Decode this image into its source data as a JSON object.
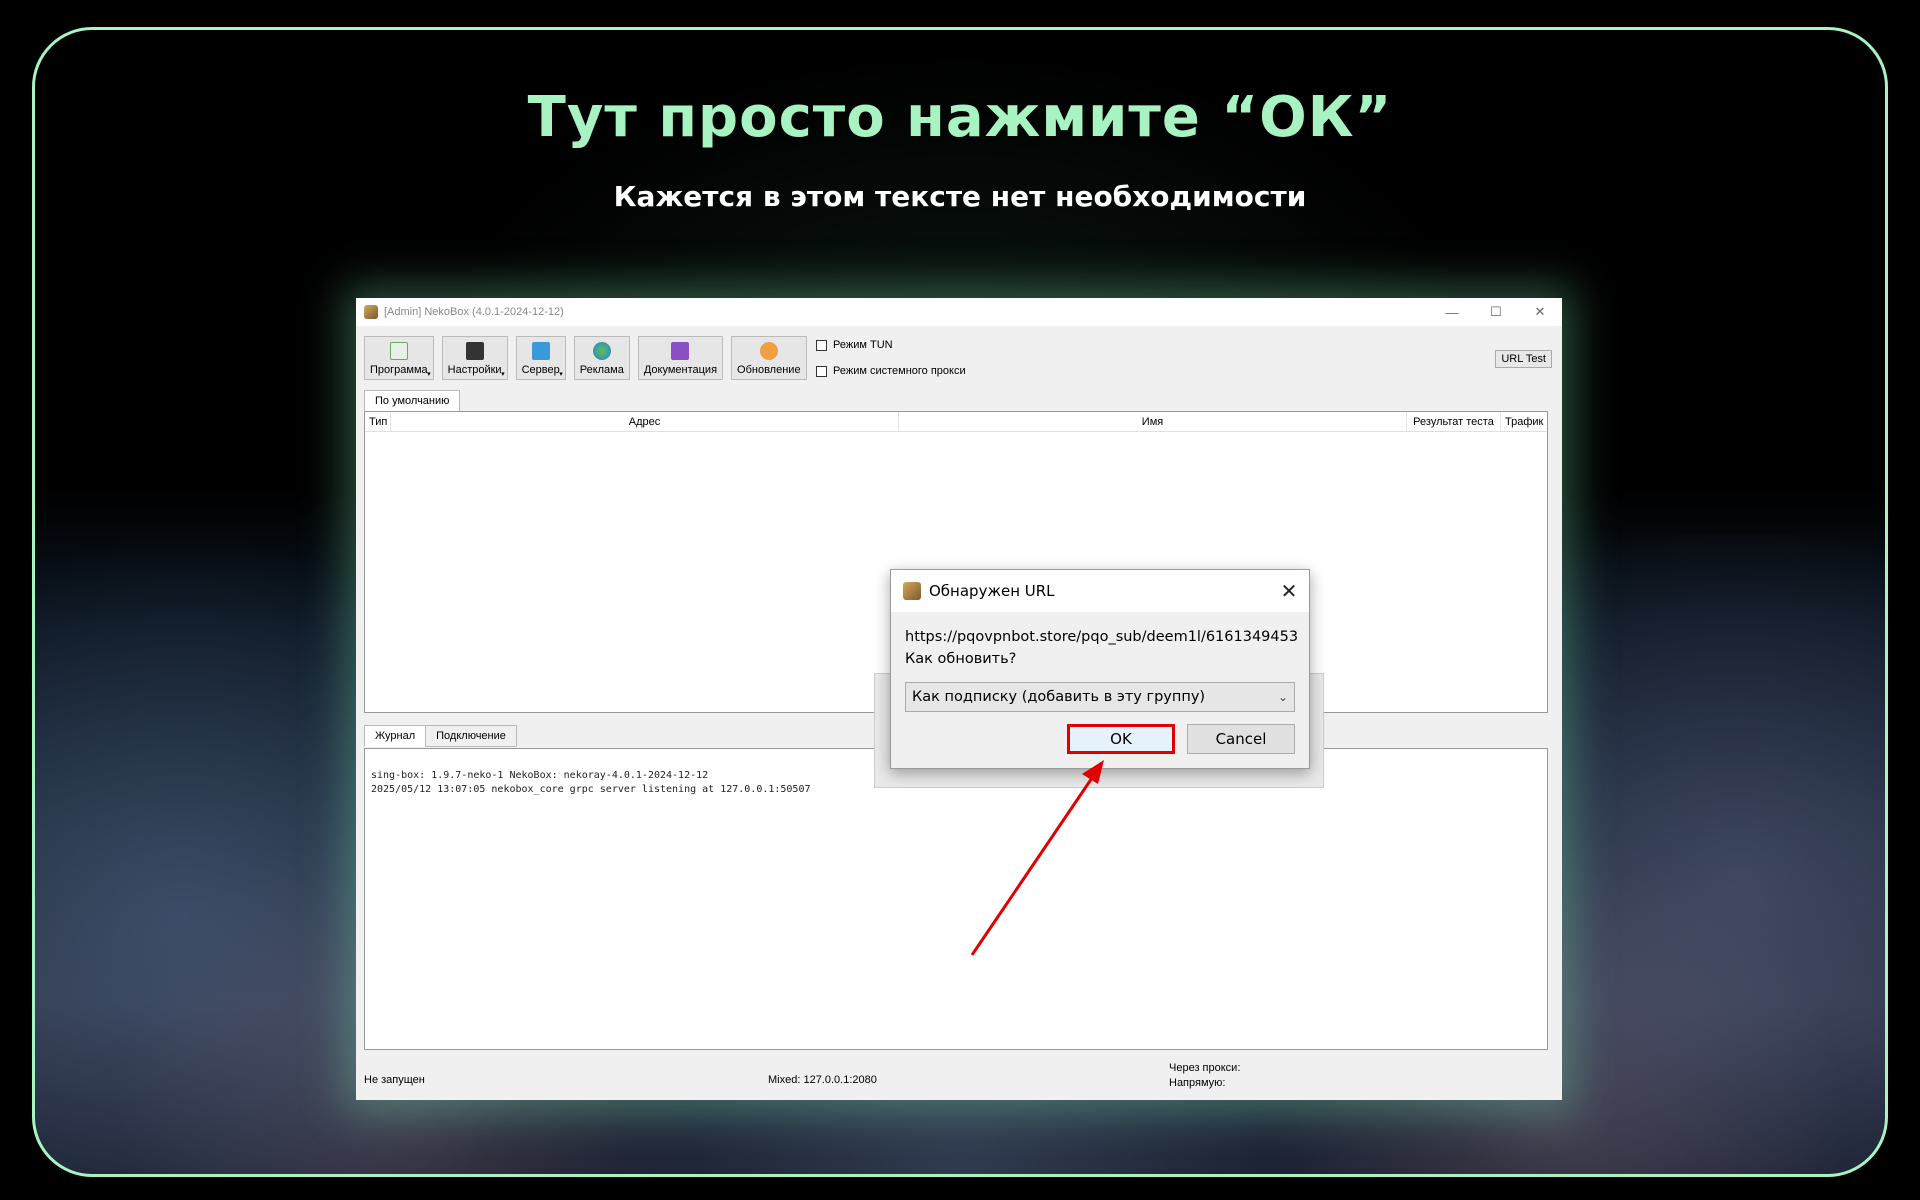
{
  "page": {
    "headline": "Тут просто нажмите “ОК”",
    "subheadline": "Кажется в этом тексте нет необходимости"
  },
  "colors": {
    "accent": "#a7f3c1",
    "highlight": "#e00000"
  },
  "window": {
    "title": "[Admin] NekoBox (4.0.1-2024-12-12)",
    "controls": [
      "minimize-icon",
      "maximize-icon",
      "close-icon"
    ],
    "toolbar": [
      {
        "label": "Программа",
        "icon": "program-icon",
        "dropdown": true
      },
      {
        "label": "Настройки",
        "icon": "settings-icon",
        "dropdown": true
      },
      {
        "label": "Сервер",
        "icon": "server-icon",
        "dropdown": true
      },
      {
        "label": "Реклама",
        "icon": "globe-icon",
        "dropdown": false
      },
      {
        "label": "Документация",
        "icon": "help-icon",
        "dropdown": false
      },
      {
        "label": "Обновление",
        "icon": "update-icon",
        "dropdown": false
      }
    ],
    "checkboxes": [
      "Режим TUN",
      "Режим системного прокси"
    ],
    "url_test": "URL Test",
    "group_tab": "По умолчанию",
    "table_headers": [
      "Тип",
      "Адрес",
      "Имя",
      "Результат теста",
      "Трафик"
    ],
    "log_tabs": [
      "Журнал",
      "Подключение"
    ],
    "log_lines": [
      "sing-box: 1.9.7-neko-1 NekoBox: nekoray-4.0.1-2024-12-12",
      "2025/05/12 13:07:05 nekobox_core grpc server listening at 127.0.0.1:50507"
    ],
    "status": {
      "state": "Не запущен",
      "mixed": "Mixed: 127.0.0.1:2080",
      "via_proxy": "Через прокси:",
      "direct": "Напрямую:"
    }
  },
  "dialog": {
    "title": "Обнаружен URL",
    "url": "https://pqovpnbot.store/pqo_sub/deem1l/6161349453",
    "question": "Как обновить?",
    "select_value": "Как подписку (добавить в эту группу)",
    "ok": "OK",
    "cancel": "Cancel"
  }
}
